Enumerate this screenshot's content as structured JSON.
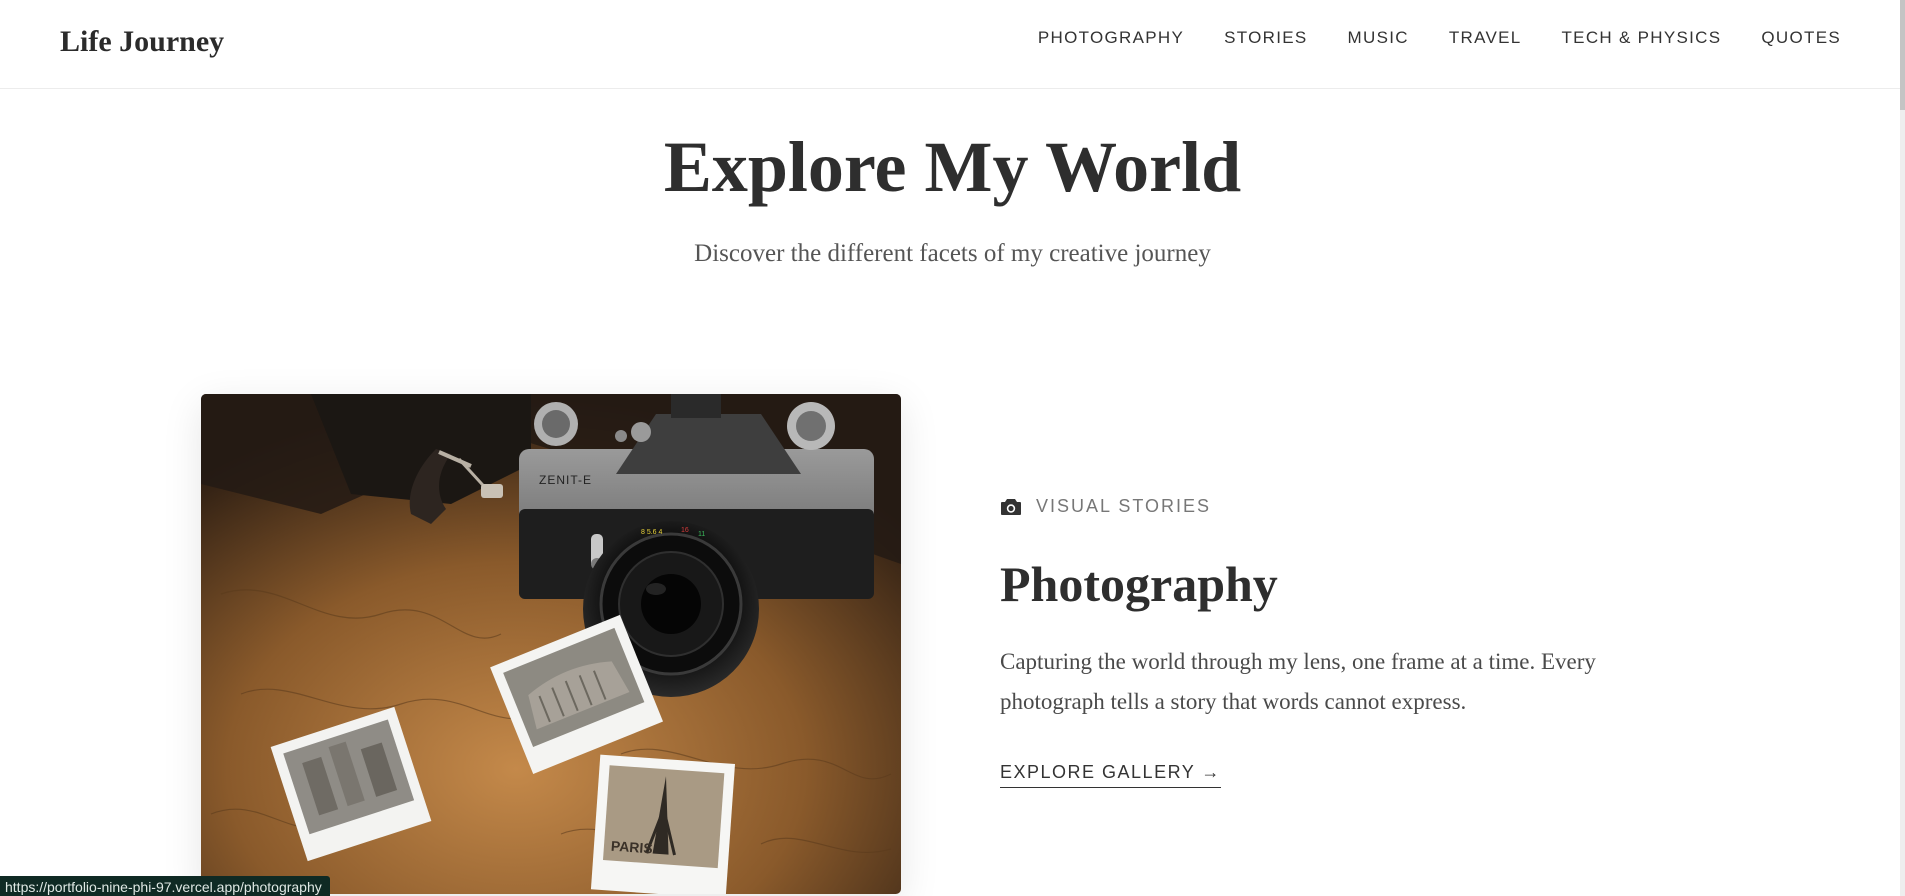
{
  "header": {
    "brand": "Life Journey",
    "nav": [
      {
        "label": "PHOTOGRAPHY"
      },
      {
        "label": "STORIES"
      },
      {
        "label": "MUSIC"
      },
      {
        "label": "TRAVEL"
      },
      {
        "label": "TECH & PHYSICS"
      },
      {
        "label": "QUOTES"
      }
    ]
  },
  "hero": {
    "title": "Explore My World",
    "subtitle": "Discover the different facets of my creative journey"
  },
  "feature": {
    "category_icon": "camera-icon",
    "category": "VISUAL STORIES",
    "title": "Photography",
    "description": "Capturing the world through my lens, one frame at a time. Every photograph tells a story that words cannot express.",
    "link_label": "EXPLORE GALLERY →",
    "image": {
      "camera_brand": "ZENIT-E",
      "postcard_label": "PARIS"
    }
  },
  "status_bar": {
    "url": "https://portfolio-nine-phi-97.vercel.app/photography"
  },
  "colors": {
    "text_dark": "#2e2e2e",
    "text_muted": "#777777",
    "status_bar_bg": "#0f2a24"
  }
}
